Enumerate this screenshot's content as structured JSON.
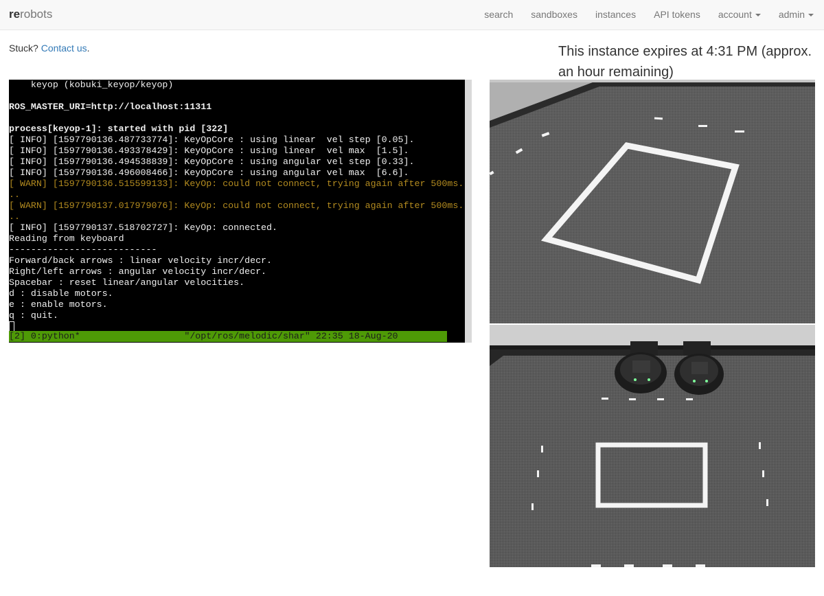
{
  "navbar": {
    "brand_bold": "re",
    "brand_rest": "robots",
    "items": [
      {
        "label": "search"
      },
      {
        "label": "sandboxes"
      },
      {
        "label": "instances"
      },
      {
        "label": "API tokens"
      },
      {
        "label": "account"
      },
      {
        "label": "admin"
      }
    ]
  },
  "help": {
    "prefix": "Stuck? ",
    "link": "Contact us",
    "suffix": "."
  },
  "expiry": {
    "text": "This instance expires at 4:31 PM (approx. an hour remaining)"
  },
  "terminal": {
    "lines": [
      {
        "text": "    keyop (kobuki_keyop/keyop)",
        "style": ""
      },
      {
        "text": "",
        "style": ""
      },
      {
        "text": "ROS_MASTER_URI=http://localhost:11311",
        "style": "bold"
      },
      {
        "text": "",
        "style": ""
      },
      {
        "text": "process[keyop-1]: started with pid [322]",
        "style": "bold"
      },
      {
        "text": "[ INFO] [1597790136.487733774]: KeyOpCore : using linear  vel step [0.05].",
        "style": ""
      },
      {
        "text": "[ INFO] [1597790136.493378429]: KeyOpCore : using linear  vel max  [1.5].",
        "style": ""
      },
      {
        "text": "[ INFO] [1597790136.494538839]: KeyOpCore : using angular vel step [0.33].",
        "style": ""
      },
      {
        "text": "[ INFO] [1597790136.496008466]: KeyOpCore : using angular vel max  [6.6].",
        "style": ""
      },
      {
        "text": "[ WARN] [1597790136.515599133]: KeyOp: could not connect, trying again after 500ms.",
        "style": "warn"
      },
      {
        "text": "..",
        "style": "warn"
      },
      {
        "text": "[ WARN] [1597790137.017979076]: KeyOp: could not connect, trying again after 500ms.",
        "style": "warn"
      },
      {
        "text": "..",
        "style": "warn"
      },
      {
        "text": "[ INFO] [1597790137.518702727]: KeyOp: connected.",
        "style": ""
      },
      {
        "text": "Reading from keyboard",
        "style": ""
      },
      {
        "text": "---------------------------",
        "style": ""
      },
      {
        "text": "Forward/back arrows : linear velocity incr/decr.",
        "style": ""
      },
      {
        "text": "Right/left arrows : angular velocity incr/decr.",
        "style": ""
      },
      {
        "text": "Spacebar : reset linear/angular velocities.",
        "style": ""
      },
      {
        "text": "d : disable motors.",
        "style": ""
      },
      {
        "text": "e : enable motors.",
        "style": ""
      },
      {
        "text": "q : quit.",
        "style": ""
      }
    ],
    "status_bar": "[2] 0:python*                   \"/opt/ros/melodic/shar\" 22:35 18-Aug-20"
  },
  "colors": {
    "terminal_bg": "#000000",
    "warn": "#b38b1f",
    "status_bar": "#4e9a06",
    "link": "#337ab7"
  }
}
